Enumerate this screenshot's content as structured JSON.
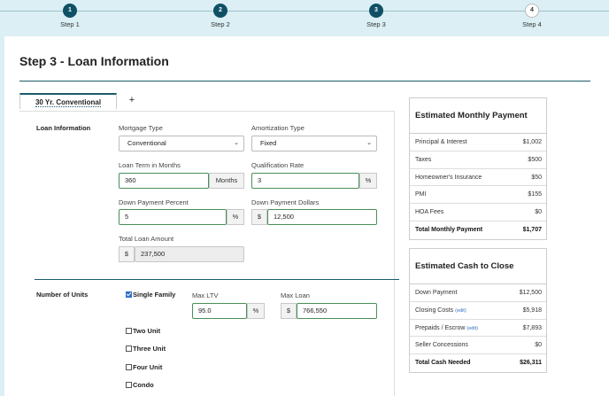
{
  "stepper": {
    "steps": [
      {
        "num": "1",
        "label": "Step 1"
      },
      {
        "num": "2",
        "label": "Step 2"
      },
      {
        "num": "3",
        "label": "Step 3"
      },
      {
        "num": "4",
        "label": "Step 4"
      }
    ],
    "current_step": 3
  },
  "page": {
    "title": "Step 3 - Loan Information"
  },
  "tabs": {
    "active_label": "30 Yr. Conventional",
    "add_label": "+"
  },
  "loan_info": {
    "section_label": "Loan Information",
    "mortgage_type_label": "Mortgage Type",
    "mortgage_type_value": "Conventional",
    "amortization_type_label": "Amortization Type",
    "amortization_type_value": "Fixed",
    "loan_term_label": "Loan Term in Months",
    "loan_term_value": "360",
    "loan_term_unit": "Months",
    "qualification_rate_label": "Qualification Rate",
    "qualification_rate_value": "3",
    "qualification_rate_unit": "%",
    "down_payment_percent_label": "Down Payment Percent",
    "down_payment_percent_value": "5",
    "down_payment_percent_unit": "%",
    "down_payment_dollars_label": "Down Payment Dollars",
    "down_payment_dollars_prefix": "$",
    "down_payment_dollars_value": "12,500",
    "total_loan_amount_label": "Total Loan Amount",
    "total_loan_amount_prefix": "$",
    "total_loan_amount_value": "237,500"
  },
  "units": {
    "section_label": "Number of Units",
    "options": [
      {
        "label": "Single Family",
        "checked": true
      },
      {
        "label": "Two Unit",
        "checked": false
      },
      {
        "label": "Three Unit",
        "checked": false
      },
      {
        "label": "Four Unit",
        "checked": false
      },
      {
        "label": "Condo",
        "checked": false
      }
    ],
    "max_ltv_label": "Max LTV",
    "max_ltv_value": "95.0",
    "max_ltv_unit": "%",
    "max_loan_label": "Max Loan",
    "max_loan_prefix": "$",
    "max_loan_value": "766,550"
  },
  "monthly_payment": {
    "title": "Estimated Monthly Payment",
    "rows": [
      {
        "label": "Principal & Interest",
        "value": "$1,002"
      },
      {
        "label": "Taxes",
        "value": "$500"
      },
      {
        "label": "Homeowner's Insurance",
        "value": "$50"
      },
      {
        "label": "PMI",
        "value": "$155"
      },
      {
        "label": "HOA Fees",
        "value": "$0"
      }
    ],
    "total_label": "Total Monthly Payment",
    "total_value": "$1,707"
  },
  "cash_to_close": {
    "title": "Estimated Cash to Close",
    "rows": [
      {
        "label": "Down Payment",
        "value": "$12,500",
        "edit": ""
      },
      {
        "label": "Closing Costs",
        "value": "$5,918",
        "edit": "(edit)"
      },
      {
        "label": "Prepaids / Escrow",
        "value": "$7,893",
        "edit": "(edit)"
      },
      {
        "label": "Seller Concessions",
        "value": "$0",
        "edit": ""
      }
    ],
    "total_label": "Total Cash Needed",
    "total_value": "$26,311"
  },
  "colors": {
    "primary": "#0f5065",
    "background": "#dbeff4",
    "valid_border": "#4a8f5a",
    "link": "#2d6fc4"
  }
}
